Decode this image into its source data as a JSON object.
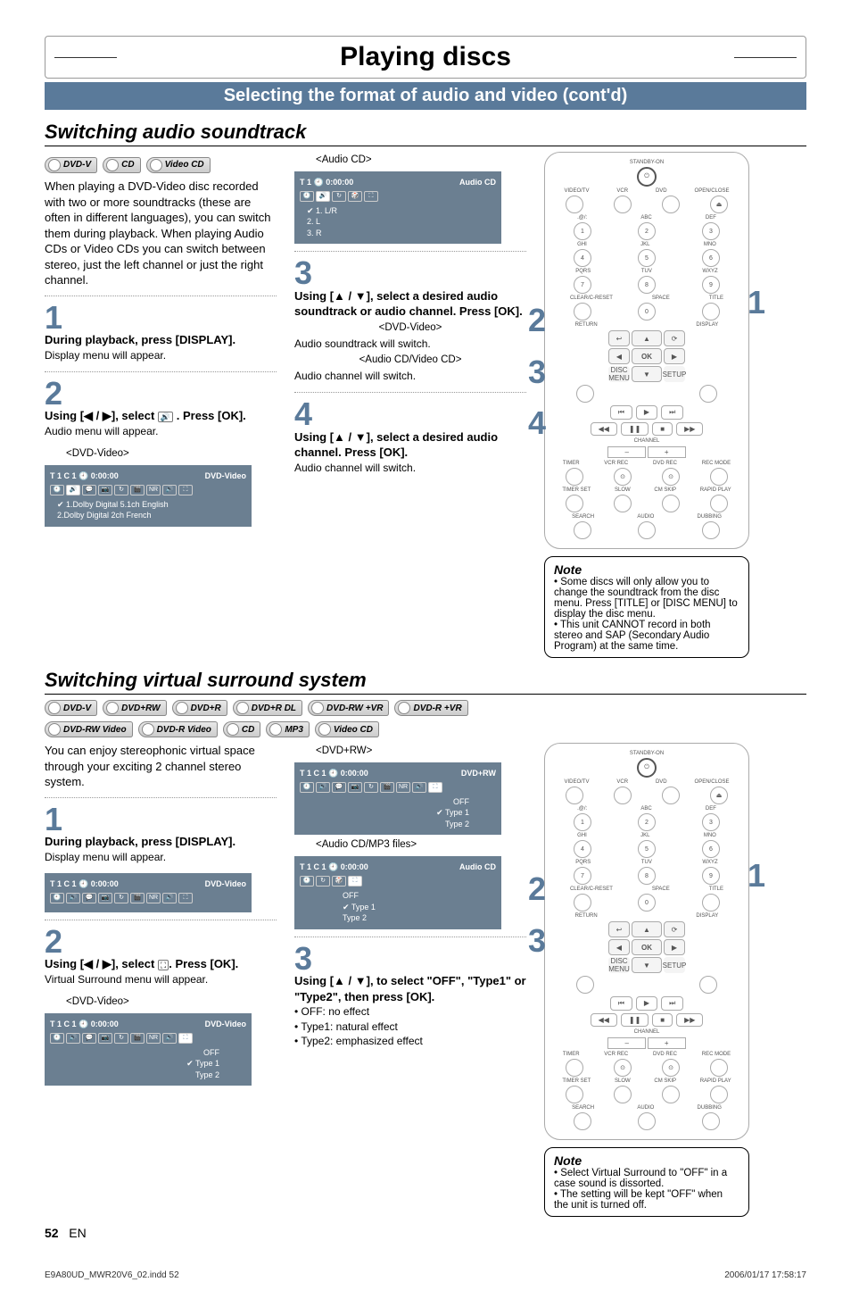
{
  "page": {
    "title": "Playing discs",
    "section_title": "Selecting the format of audio and video (cont'd)",
    "page_number": "52",
    "page_lang": "EN",
    "foot_file": "E9A80UD_MWR20V6_02.indd   52",
    "foot_time": "2006/01/17   17:58:17"
  },
  "audio": {
    "heading": "Switching audio soundtrack",
    "badges": [
      "DVD-V",
      "CD",
      "Video CD"
    ],
    "intro": "When playing a DVD-Video disc recorded with two or more soundtracks (these are often in different languages), you can switch them during playback. When playing Audio CDs or Video CDs you can switch between stereo, just the left channel or just the right channel.",
    "step1_num": "1",
    "step1_head": "During playback, press [DISPLAY].",
    "step1_sub": "Display menu will appear.",
    "step2_num": "2",
    "step2_head_a": "Using [◀ / ▶], select ",
    "step2_head_b": ". Press [OK].",
    "step2_sub": "Audio menu will appear.",
    "osd1_cap": "<DVD-Video>",
    "osd1_head_time": "T 1  C 1  🕘 0:00:00",
    "osd1_head_type": "DVD-Video",
    "osd1_item1": "1.Dolby Digital 5.1ch English",
    "osd1_item2": "2.Dolby Digital 2ch French",
    "osd2_cap": "<Audio CD>",
    "osd2_head_time": "T 1   🕘 0:00:00",
    "osd2_head_type": "Audio CD",
    "osd2_item1": "1. L/R",
    "osd2_item2": "2. L",
    "osd2_item3": "3. R",
    "step3_num": "3",
    "step3_head": "Using [▲ / ▼], select a desired audio soundtrack or audio channel. Press [OK].",
    "step3_cap1": "<DVD-Video>",
    "step3_sub1": "Audio soundtrack will switch.",
    "step3_cap2": "<Audio CD/Video CD>",
    "step3_sub2": "Audio channel will switch.",
    "step4_num": "4",
    "step4_head": "Using [▲ / ▼], select a desired audio channel. Press [OK].",
    "step4_sub": "Audio channel will switch.",
    "callout_1": "1",
    "callout_2": "2",
    "callout_3": "3",
    "callout_4": "4",
    "note_head": "Note",
    "note_1": "Some discs will only allow you to change the soundtrack from the disc menu. Press [TITLE] or [DISC MENU] to display the disc menu.",
    "note_2": "This unit CANNOT record in both stereo and SAP (Secondary Audio Program) at the same time."
  },
  "surround": {
    "heading": "Switching virtual surround system",
    "badges_row1": [
      "DVD-V",
      "DVD+RW",
      "DVD+R",
      "DVD+R DL",
      "DVD-RW +VR",
      "DVD-R +VR"
    ],
    "badges_row2": [
      "DVD-RW Video",
      "DVD-R Video",
      "CD",
      "MP3",
      "Video CD"
    ],
    "intro": "You can enjoy stereophonic virtual space through your exciting 2 channel stereo system.",
    "step1_num": "1",
    "step1_head": "During playback, press [DISPLAY].",
    "step1_sub": "Display menu will appear.",
    "osdA_head_time": "T 1  C 1  🕘 0:00:00",
    "osdA_head_type": "DVD-Video",
    "step2_num": "2",
    "step2_head_a": "Using [◀ / ▶], select ",
    "step2_head_b": ". Press [OK].",
    "step2_sub": "Virtual Surround menu will appear.",
    "osdB_cap": "<DVD-Video>",
    "osdB_head_time": "T 1  C 1  🕘 0:00:00",
    "osdB_head_type": "DVD-Video",
    "osdB_o1": "OFF",
    "osdB_o2": "Type 1",
    "osdB_o3": "Type 2",
    "osdC_cap": "<DVD+RW>",
    "osdC_head_time": "T 1  C 1  🕘 0:00:00",
    "osdC_head_type": "DVD+RW",
    "osdC_o1": "OFF",
    "osdC_o2": "Type 1",
    "osdC_o3": "Type 2",
    "osdD_cap": "<Audio CD/MP3 files>",
    "osdD_head_time": "T 1  C 1  🕘 0:00:00",
    "osdD_head_type": "Audio CD",
    "osdD_o1": "OFF",
    "osdD_o2": "Type 1",
    "osdD_o3": "Type 2",
    "step3_num": "3",
    "step3_head": "Using [▲ / ▼], to select \"OFF\", \"Type1\" or \"Type2\", then press [OK].",
    "step3_b1": "OFF:   no effect",
    "step3_b2": "Type1: natural effect",
    "step3_b3": "Type2: emphasized effect",
    "callout_1": "1",
    "callout_2": "2",
    "callout_3": "3",
    "note_head": "Note",
    "note_1": "Select Virtual Surround to \"OFF\" in a case sound is dissorted.",
    "note_2": "The setting will be kept \"OFF\" when the unit is turned off."
  },
  "remote": {
    "standby": "STANDBY-ON",
    "video_tv": "VIDEO/TV",
    "vcr": "VCR",
    "dvd": "DVD",
    "open_close": "OPEN/CLOSE",
    "row1": [
      "1",
      "2",
      "3"
    ],
    "row1lbl": [
      ".@/:",
      "ABC",
      "DEF"
    ],
    "row2": [
      "4",
      "5",
      "6"
    ],
    "row2lbl": [
      "GHI",
      "JKL",
      "MNO"
    ],
    "row3": [
      "7",
      "8",
      "9"
    ],
    "row3lbl": [
      "PQRS",
      "TUV",
      "WXYZ"
    ],
    "row4lbl": [
      "CLEAR/C-RESET",
      "SPACE",
      "TITLE"
    ],
    "row4": [
      "",
      "0",
      ""
    ],
    "return": "RETURN",
    "display": "DISPLAY",
    "ok": "OK",
    "disc_menu": "DISC MENU",
    "setup": "SETUP",
    "channel": "CHANNEL",
    "minus": "–",
    "plus": "+",
    "bot_row1": [
      "TIMER",
      "VCR REC",
      "DVD REC",
      "REC MODE"
    ],
    "bot_row2": [
      "TIMER SET",
      "SLOW",
      "CM SKIP",
      "RAPID PLAY"
    ],
    "bot_row3": [
      "SEARCH",
      "AUDIO",
      "DUBBING"
    ]
  }
}
